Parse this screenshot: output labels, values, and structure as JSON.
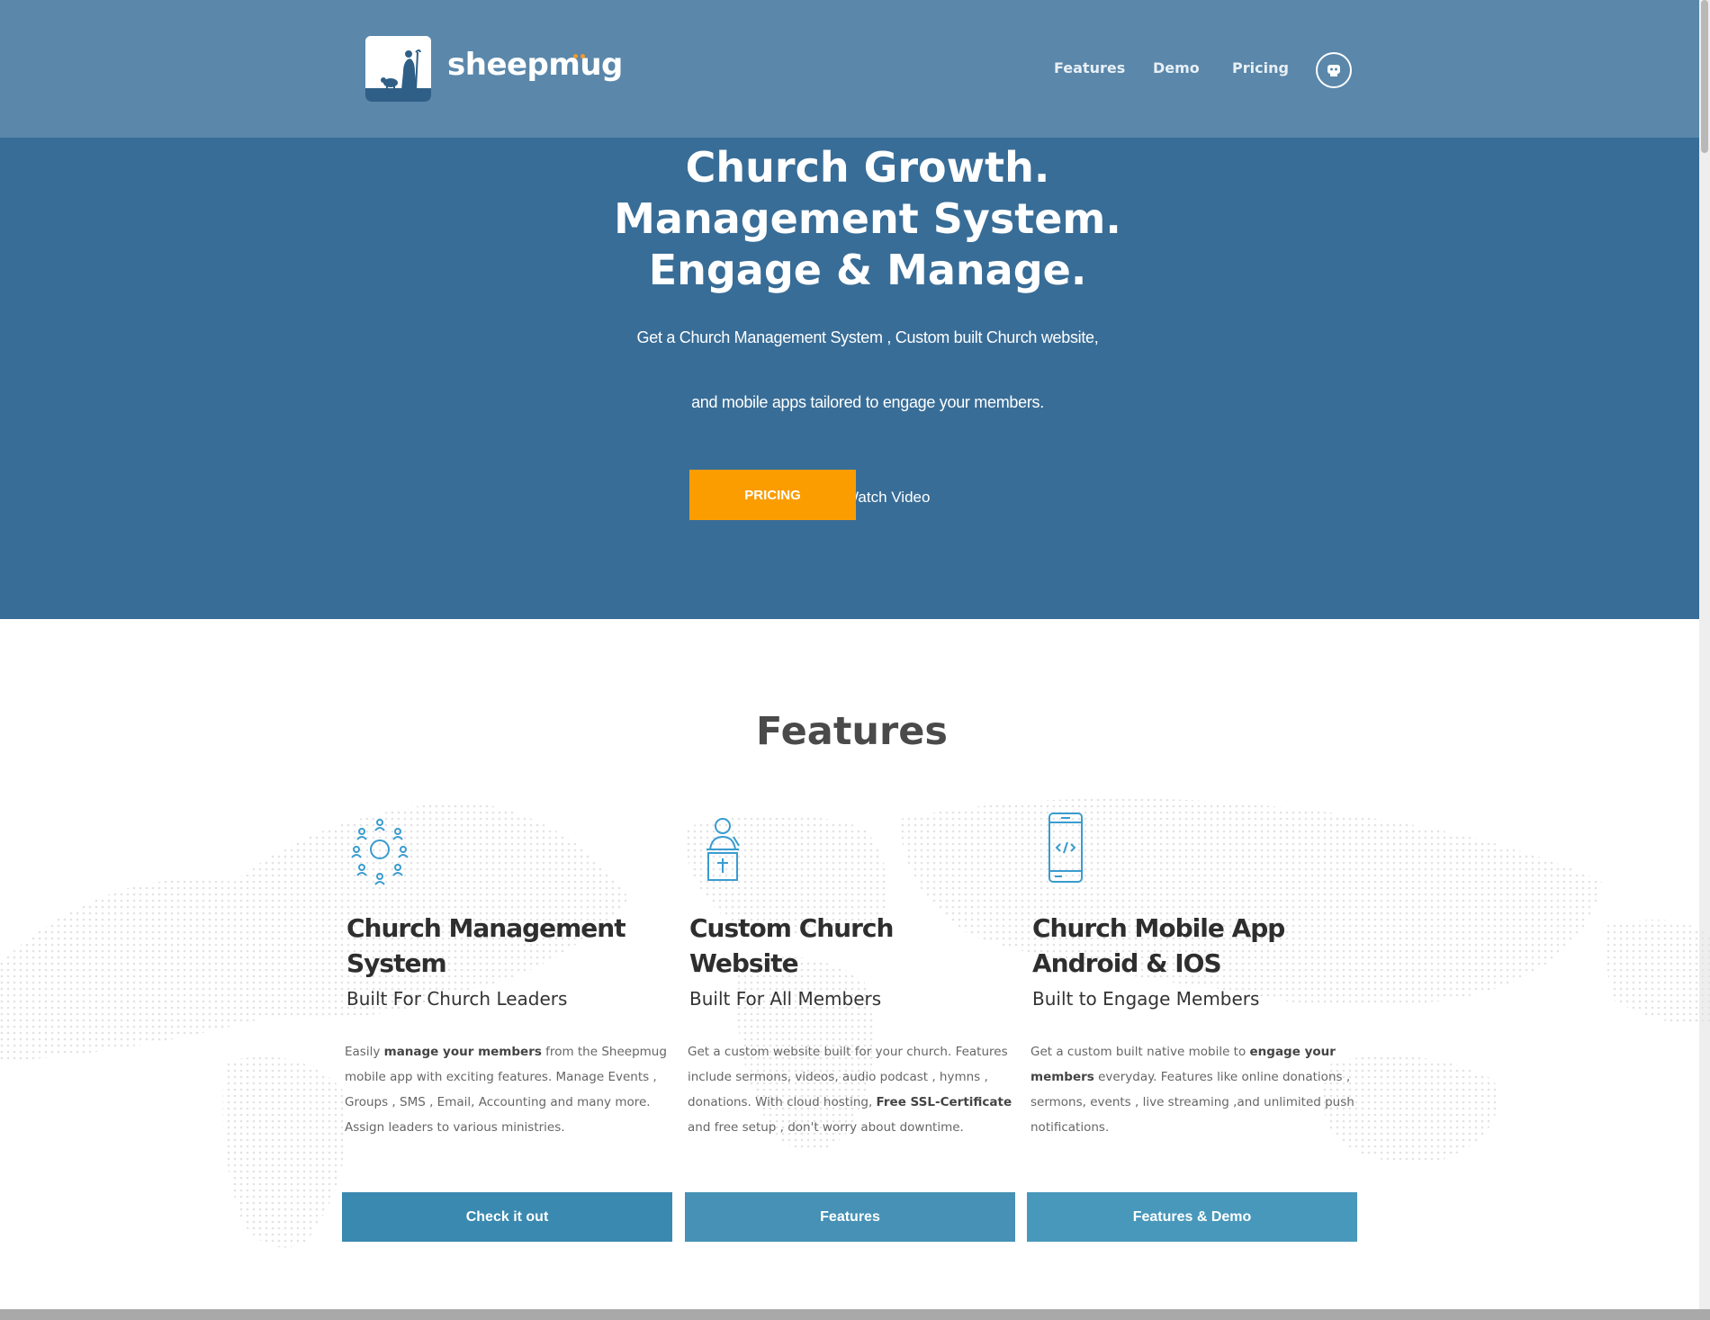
{
  "header": {
    "brand": "sheepmug",
    "nav": [
      {
        "label": "Features"
      },
      {
        "label": "Demo"
      },
      {
        "label": "Pricing"
      }
    ]
  },
  "hero": {
    "title_lines": [
      "Church Growth.",
      "Management System.",
      "Engage & Manage."
    ],
    "subtitle_line1": "Get a Church Management System , Custom built Church  website,",
    "subtitle_line2": "and mobile apps tailored to engage your members.",
    "primary_button": "PRICING",
    "secondary_link": "Watch Video"
  },
  "features": {
    "heading": "Features",
    "cards": [
      {
        "icon": "people-network-icon",
        "title": "Church Management System",
        "subtitle": "Built For Church Leaders",
        "desc_parts": [
          "Easily ",
          "manage your members",
          " from the Sheepmug mobile app with exciting features.  Manage  Events , Groups , SMS , Email, Accounting and many more. Assign leaders to various ministries."
        ],
        "button": "Check it out"
      },
      {
        "icon": "preacher-pulpit-icon",
        "title": "Custom Church Website",
        "subtitle": "Built For All Members",
        "desc_parts": [
          "Get a custom website built for your church. Features include sermons, videos, audio podcast , hymns , donations. With cloud hosting, ",
          "Free SSL-Certificate",
          " and free setup , don't worry about downtime."
        ],
        "button": "Features"
      },
      {
        "icon": "mobile-code-icon",
        "title": "Church Mobile App Android & IOS",
        "subtitle": "Built to Engage Members",
        "desc_parts": [
          "Get a custom built native mobile to ",
          "engage your members",
          " everyday. Features like online donations , sermons, events , live streaming ,and unlimited push notifications."
        ],
        "button": "Features & Demo"
      }
    ]
  },
  "colors": {
    "hero_bg": "#386d97",
    "topbar_bg": "#5a87aa",
    "accent_orange": "#fb9d00",
    "card_button": "#3a89b0",
    "heading_text": "#4a4a4a"
  }
}
